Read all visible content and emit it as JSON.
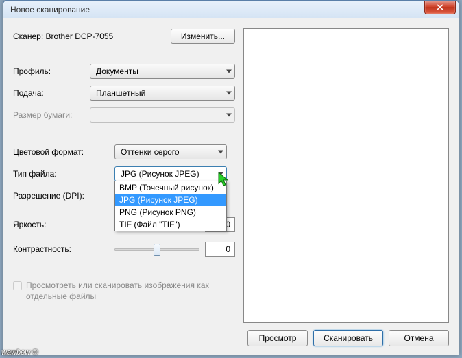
{
  "title": "Новое сканирование",
  "scanner": {
    "label": "Сканер:",
    "value": "Brother DCP-7055",
    "change_btn": "Изменить..."
  },
  "profile": {
    "label": "Профиль:",
    "value": "Документы"
  },
  "feed": {
    "label": "Подача:",
    "value": "Планшетный"
  },
  "papersize": {
    "label": "Размер бумаги:",
    "value": ""
  },
  "colorformat": {
    "label": "Цветовой формат:",
    "value": "Оттенки серого"
  },
  "filetype": {
    "label": "Тип файла:",
    "value": "JPG (Рисунок JPEG)",
    "options": [
      "BMP (Точечный рисунок)",
      "JPG (Рисунок JPEG)",
      "PNG (Рисунок PNG)",
      "TIF (Файл \"TIF\")"
    ]
  },
  "dpi": {
    "label": "Разрешение (DPI):",
    "value": ""
  },
  "brightness": {
    "label": "Яркость:",
    "value": "0"
  },
  "contrast": {
    "label": "Контрастность:",
    "value": "0"
  },
  "checkbox": {
    "label": "Просмотреть или сканировать изображения как отдельные файлы"
  },
  "footer": {
    "preview": "Просмотр",
    "scan": "Сканировать",
    "cancel": "Отмена"
  },
  "watermark": "wawbew ©"
}
